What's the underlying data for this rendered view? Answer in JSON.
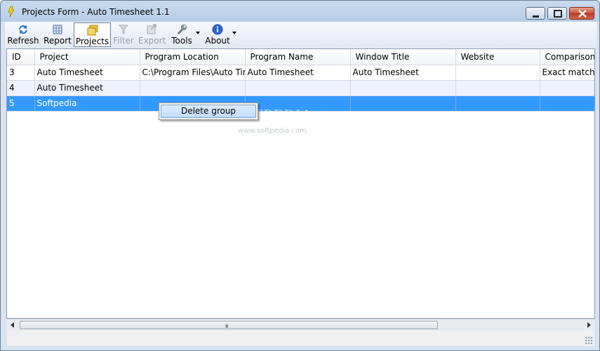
{
  "window": {
    "title": "Projects Form - Auto Timesheet 1.1"
  },
  "toolbar": {
    "refresh_label": "Refresh",
    "report_label": "Report",
    "projects_label": "Projects",
    "filter_label": "Filter",
    "export_label": "Export",
    "tools_label": "Tools",
    "about_label": "About"
  },
  "table": {
    "columns": [
      "ID",
      "Project",
      "Program Location",
      "Program Name",
      "Window Title",
      "Website",
      "Comparison"
    ],
    "rows": [
      [
        "3",
        "Auto Timesheet",
        "C:\\Program Files\\Auto Time...",
        "Auto Timesheet",
        "Auto Timesheet",
        "",
        "Exact match"
      ],
      [
        "4",
        "Auto Timesheet",
        "",
        "",
        "",
        "",
        ""
      ],
      [
        "5",
        "Softpedia",
        "",
        "",
        "",
        "",
        ""
      ]
    ],
    "selected_row_id": "5"
  },
  "context_menu": {
    "items": [
      "Delete group"
    ]
  },
  "watermark": {
    "text": "SOFTPEDIA",
    "url": "www.softpedia.com"
  },
  "scrollbar": {
    "grip": "III"
  },
  "colors": {
    "selection": "#3399ff",
    "alt_row": "#eef2fb"
  }
}
